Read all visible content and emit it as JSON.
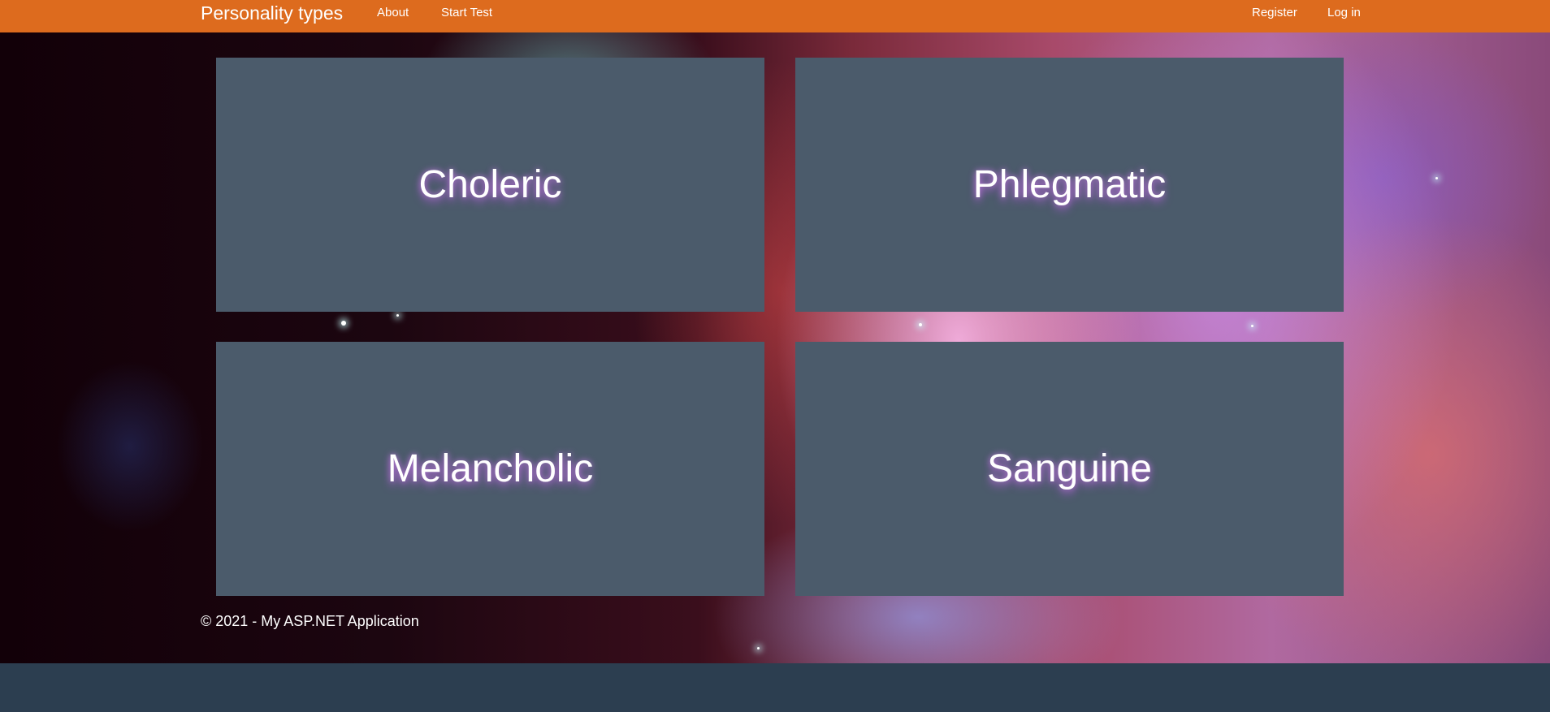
{
  "navbar": {
    "brand": "Personality types",
    "links": {
      "about": "About",
      "start_test": "Start Test",
      "register": "Register",
      "log_in": "Log in"
    }
  },
  "cards": [
    {
      "title": "Choleric"
    },
    {
      "title": "Phlegmatic"
    },
    {
      "title": "Melancholic"
    },
    {
      "title": "Sanguine"
    }
  ],
  "footer": {
    "copyright": "© 2021 - My ASP.NET Application"
  },
  "colors": {
    "navbar": "#dd6b1e",
    "card": "#4b5b6b",
    "page_bottom": "#2c3e50",
    "text": "#ffffff"
  }
}
